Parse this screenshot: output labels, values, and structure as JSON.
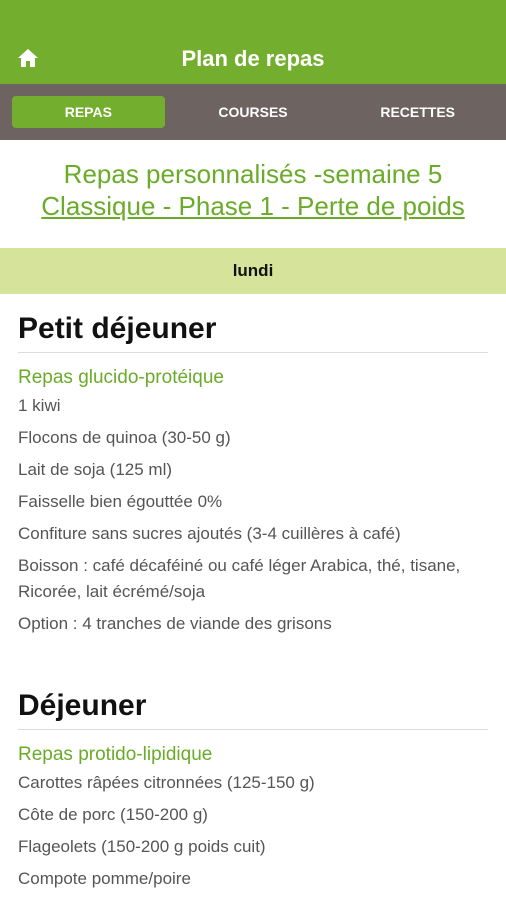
{
  "header": {
    "title": "Plan de repas",
    "home_icon": "home-icon"
  },
  "tabs": [
    {
      "label": "REPAS",
      "active": true
    },
    {
      "label": "COURSES",
      "active": false
    },
    {
      "label": "RECETTES",
      "active": false
    }
  ],
  "plan": {
    "title": "Repas personnalisés -semaine 5",
    "subtitle": "Classique - Phase 1 - Perte de poids"
  },
  "day": "lundi",
  "meals": [
    {
      "title": "Petit déjeuner",
      "type": "Repas glucido-protéique",
      "items": [
        "1 kiwi",
        "Flocons de quinoa (30-50 g)",
        "Lait de soja (125 ml)",
        "Faisselle bien égouttée 0%",
        "Confiture sans sucres ajoutés (3-4 cuillères à café)",
        "Boisson : café décaféiné ou café léger Arabica, thé, tisane, Ricorée, lait écrémé/soja",
        "Option : 4 tranches de viande des grisons"
      ]
    },
    {
      "title": "Déjeuner",
      "type": "Repas protido-lipidique",
      "items": [
        "Carottes râpées citronnées (125-150 g)",
        "Côte de porc (150-200 g)",
        "Flageolets (150-200 g poids cuit)",
        "Compote pomme/poire"
      ]
    }
  ],
  "colors": {
    "green": "#74ae2e",
    "tabbar": "#6d6461",
    "day_bar": "#d5e39b"
  }
}
